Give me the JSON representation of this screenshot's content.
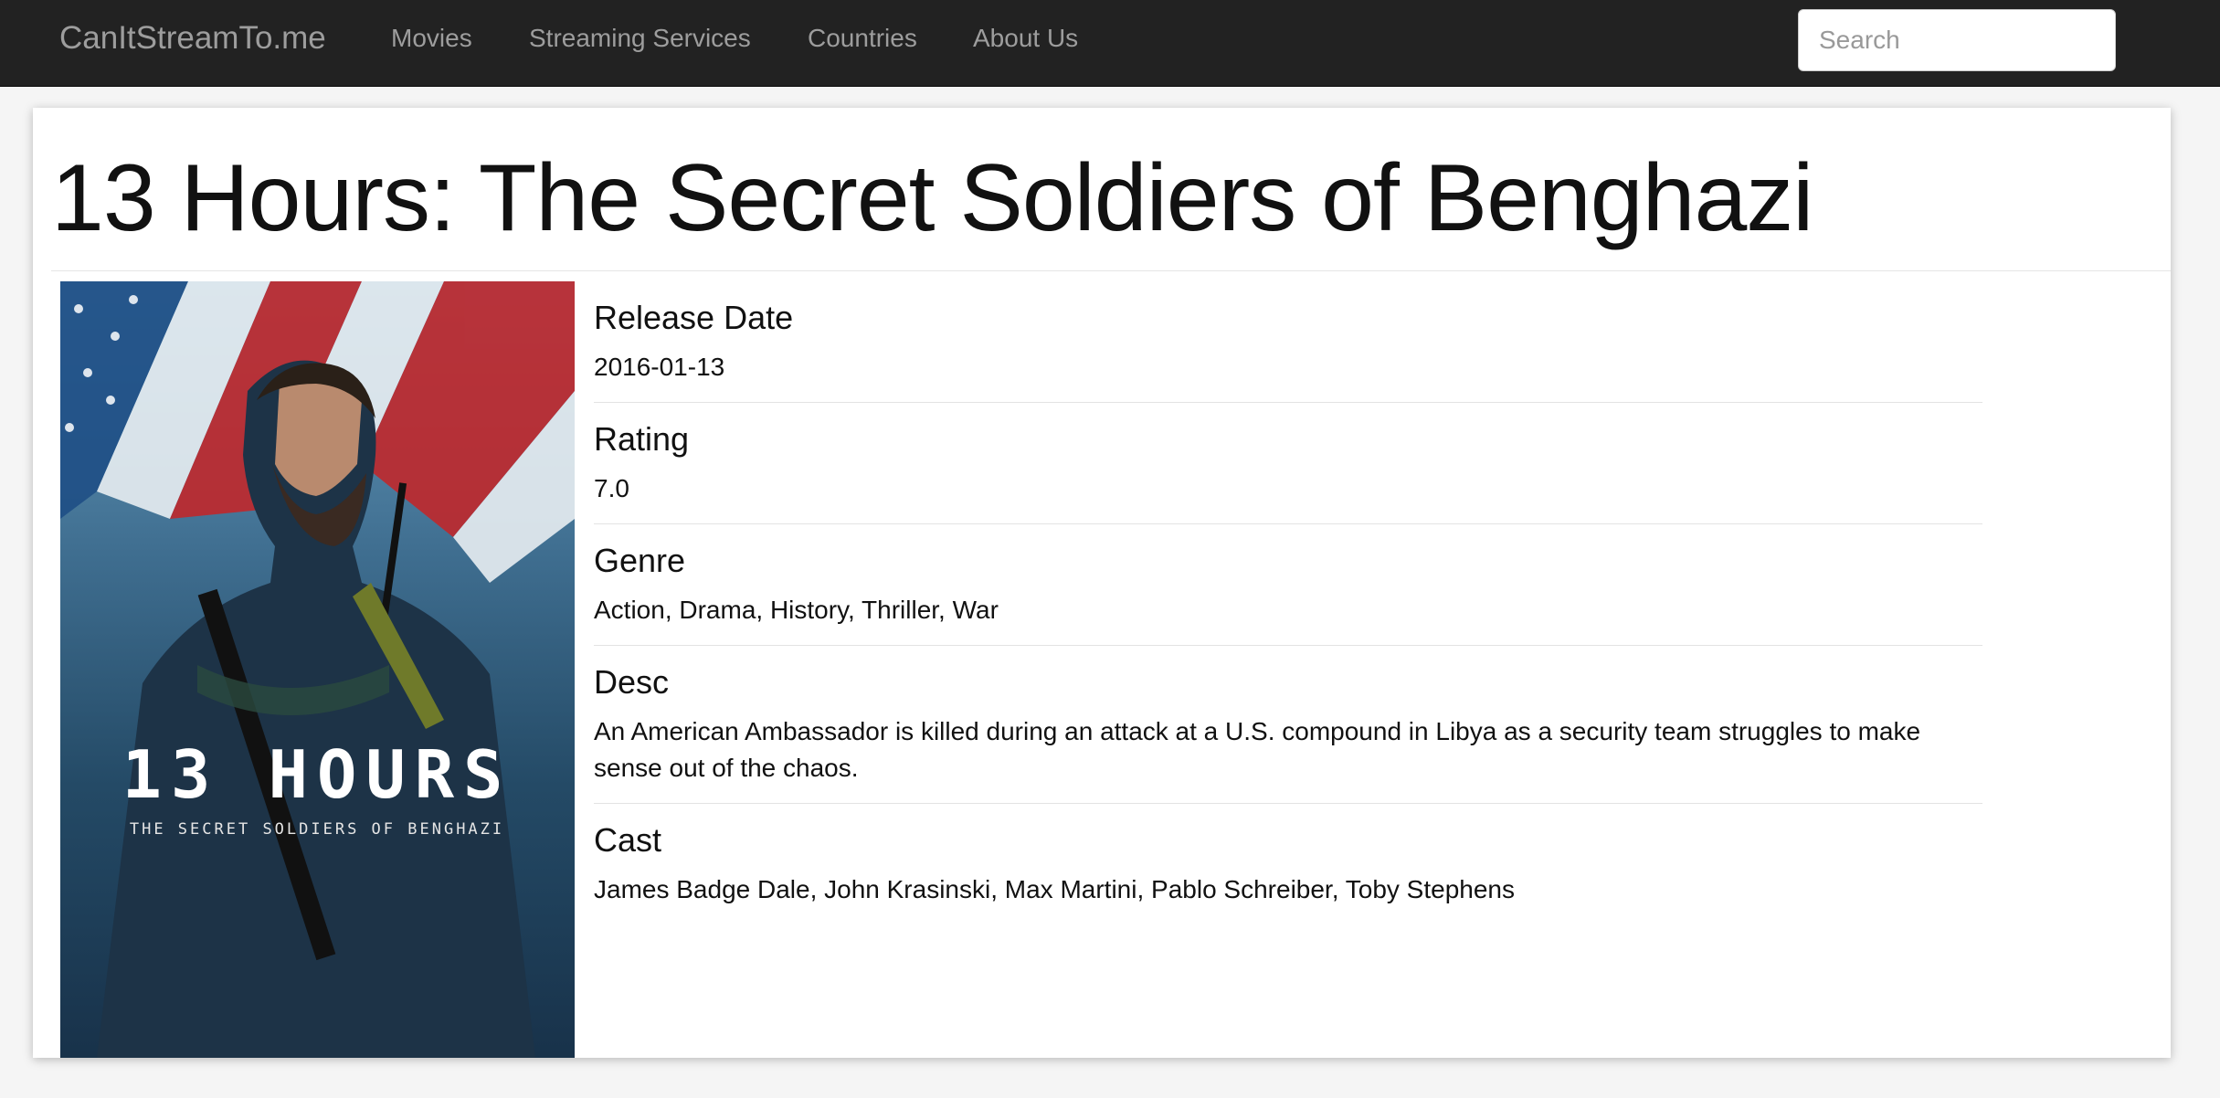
{
  "navbar": {
    "brand": "CanItStreamTo.me",
    "links": [
      "Movies",
      "Streaming Services",
      "Countries",
      "About Us"
    ],
    "search_placeholder": "Search"
  },
  "movie": {
    "title": "13 Hours: The Secret Soldiers of Benghazi",
    "poster": {
      "title_text": "13 HOURS",
      "subtitle_text": "THE SECRET SOLDIERS OF BENGHAZI"
    },
    "fields": [
      {
        "label": "Release Date",
        "value": "2016-01-13"
      },
      {
        "label": "Rating",
        "value": "7.0"
      },
      {
        "label": "Genre",
        "value": "Action, Drama, History, Thriller, War"
      },
      {
        "label": "Desc",
        "value": "An American Ambassador is killed during an attack at a U.S. compound in Libya as a security team struggles to make sense out of the chaos."
      },
      {
        "label": "Cast",
        "value": "James Badge Dale, John Krasinski, Max Martini, Pablo Schreiber, Toby Stephens"
      }
    ]
  }
}
